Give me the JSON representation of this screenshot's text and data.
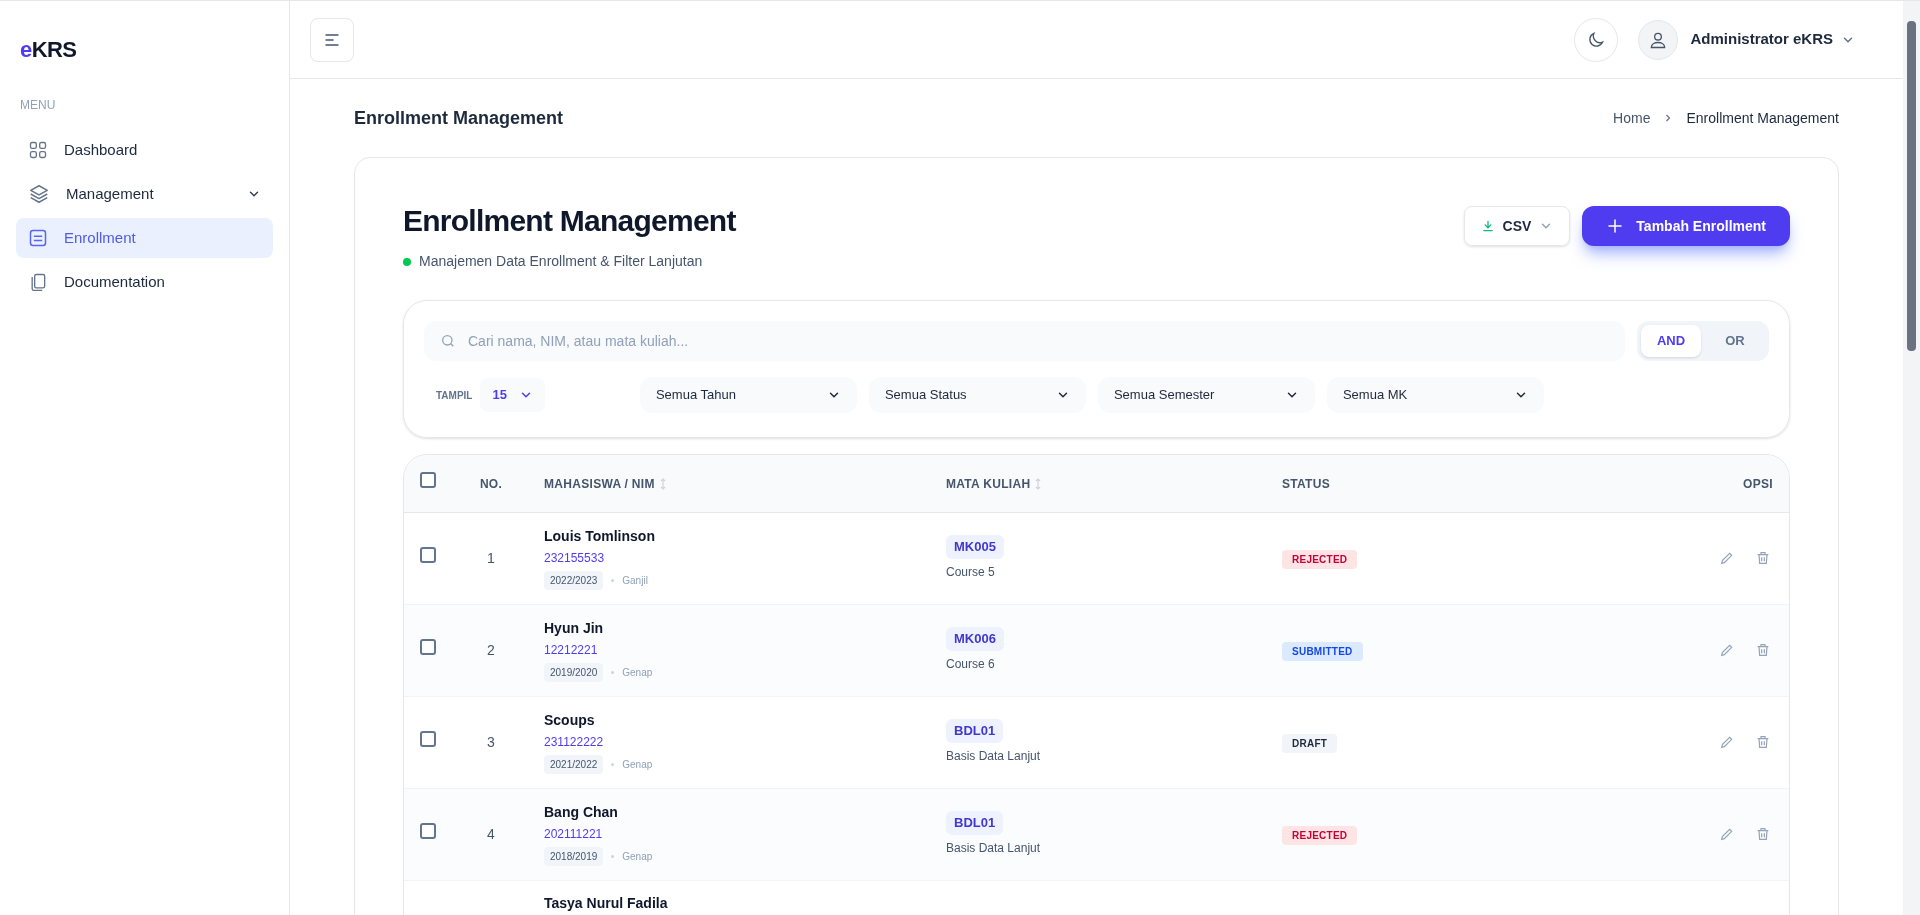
{
  "sidebar": {
    "logo": {
      "accent": "e",
      "rest": "KRS"
    },
    "section_label": "MENU",
    "items": [
      {
        "label": "Dashboard",
        "selected": false,
        "has_submenu": false
      },
      {
        "label": "Management",
        "selected": false,
        "has_submenu": true
      },
      {
        "label": "Enrollment",
        "selected": true,
        "has_submenu": false
      },
      {
        "label": "Documentation",
        "selected": false,
        "has_submenu": false
      }
    ]
  },
  "topbar": {
    "user_name": "Administrator eKRS"
  },
  "page": {
    "title": "Enrollment Management",
    "breadcrumb": [
      "Home",
      "Enrollment Management"
    ]
  },
  "card": {
    "title": "Enrollment Management",
    "subtitle": "Manajemen Data Enrollment & Filter Lanjutan",
    "export_button": "CSV",
    "add_button": "Tambah Enrollment"
  },
  "filters": {
    "search": {
      "placeholder": "Cari nama, NIM, atau mata kuliah..."
    },
    "logic": [
      {
        "label": "AND",
        "selected": true
      },
      {
        "label": "OR",
        "selected": false
      }
    ],
    "page_size_label": "TAMPIL",
    "page_size": "15",
    "selects": [
      "Semua Tahun",
      "Semua Status",
      "Semua Semester",
      "Semua MK"
    ]
  },
  "table": {
    "select_all_checked": false,
    "columns": [
      {
        "label": "NO.",
        "sortable": false
      },
      {
        "label": "MAHASISWA / NIM",
        "sortable": true
      },
      {
        "label": "MATA KULIAH",
        "sortable": true
      },
      {
        "label": "STATUS",
        "sortable": false
      },
      {
        "label": "OPSI",
        "sortable": false
      }
    ],
    "rows": [
      {
        "checked": false,
        "no": "1",
        "name": "Louis Tomlinson",
        "nim": "232155533",
        "year": "2022/2023",
        "semester": "Ganjil",
        "course_code": "MK005",
        "course_name": "Course 5",
        "status": {
          "label": "REJECTED",
          "kind": "rejected"
        }
      },
      {
        "checked": false,
        "no": "2",
        "name": "Hyun Jin",
        "nim": "12212221",
        "year": "2019/2020",
        "semester": "Genap",
        "course_code": "MK006",
        "course_name": "Course 6",
        "status": {
          "label": "SUBMITTED",
          "kind": "submitted"
        }
      },
      {
        "checked": false,
        "no": "3",
        "name": "Scoups",
        "nim": "231122222",
        "year": "2021/2022",
        "semester": "Genap",
        "course_code": "BDL01",
        "course_name": "Basis Data Lanjut",
        "status": {
          "label": "DRAFT",
          "kind": "draft"
        }
      },
      {
        "checked": false,
        "no": "4",
        "name": "Bang Chan",
        "nim": "202111221",
        "year": "2018/2019",
        "semester": "Genap",
        "course_code": "BDL01",
        "course_name": "Basis Data Lanjut",
        "status": {
          "label": "REJECTED",
          "kind": "rejected"
        }
      },
      {
        "name": "Tasya Nurul Fadila"
      }
    ]
  }
}
